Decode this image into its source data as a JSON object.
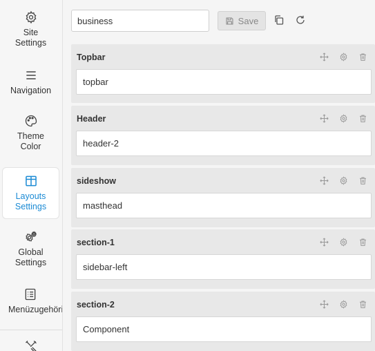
{
  "sidebar": {
    "items": [
      {
        "label": "Site\nSettings",
        "icon": "gear-icon"
      },
      {
        "label": "Navigation",
        "icon": "menu-icon"
      },
      {
        "label": "Theme\nColor",
        "icon": "palette-icon"
      },
      {
        "label": "Layouts\nSettings",
        "icon": "layout-icon",
        "active": true
      },
      {
        "label": "Global\nSettings",
        "icon": "gears-icon"
      },
      {
        "label": "Menüzugehörigkeit",
        "icon": "checklist-icon"
      },
      {
        "label": "",
        "icon": "tools-icon"
      }
    ]
  },
  "toolbar": {
    "layout_name": "business",
    "save_label": "Save",
    "copy_icon": "copy-icon",
    "refresh_icon": "refresh-icon"
  },
  "sections": [
    {
      "title": "Topbar",
      "value": "topbar"
    },
    {
      "title": "Header",
      "value": "header-2"
    },
    {
      "title": "sideshow",
      "value": "masthead"
    },
    {
      "title": "section-1",
      "value": "sidebar-left"
    },
    {
      "title": "section-2",
      "value": "Component"
    }
  ],
  "colors": {
    "accent": "#1a8ad4",
    "sidebar_bg": "#f6f6f6",
    "section_bg": "#e8e8e8"
  }
}
